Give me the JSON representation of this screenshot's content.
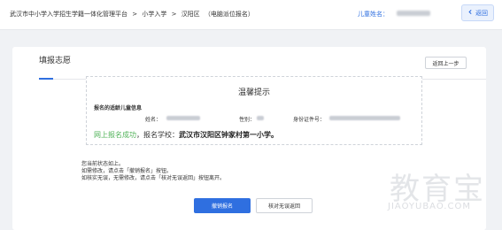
{
  "header": {
    "breadcrumb": [
      "武汉市中小学入学招生学籍一体化管理平台",
      ">",
      "小学入学",
      ">",
      "汉阳区",
      "（电脑派位报名）"
    ],
    "child_name_label": "儿童姓名：",
    "back_label": "返回",
    "back_icon": "arrow-left-icon"
  },
  "card": {
    "title": "填报志愿",
    "prev_step_label": "返回上一步"
  },
  "notice": {
    "title": "温馨提示",
    "subtitle": "报名的适龄儿童信息",
    "name_label": "姓名：",
    "gender_label": "性别：",
    "id_label": "身份证件号：",
    "success_text": "网上报名成功",
    "school_prefix": "，报名学校：",
    "school_name": "武汉市汉阳区钟家村第一小学。"
  },
  "description": {
    "line1": "您当前状态如上。",
    "line2": "如需修改，请点击「撤销报名」按钮。",
    "line3": "如核实无误，无需修改，请点击「核对无误返回」按钮离开。"
  },
  "buttons": {
    "cancel_label": "撤销报名",
    "confirm_label": "核对无误返回"
  },
  "watermark": {
    "text": "教育宝",
    "en": "JIAOYUBAO.COM"
  },
  "colors": {
    "accent": "#2f6fe0",
    "success": "#52b35a"
  }
}
